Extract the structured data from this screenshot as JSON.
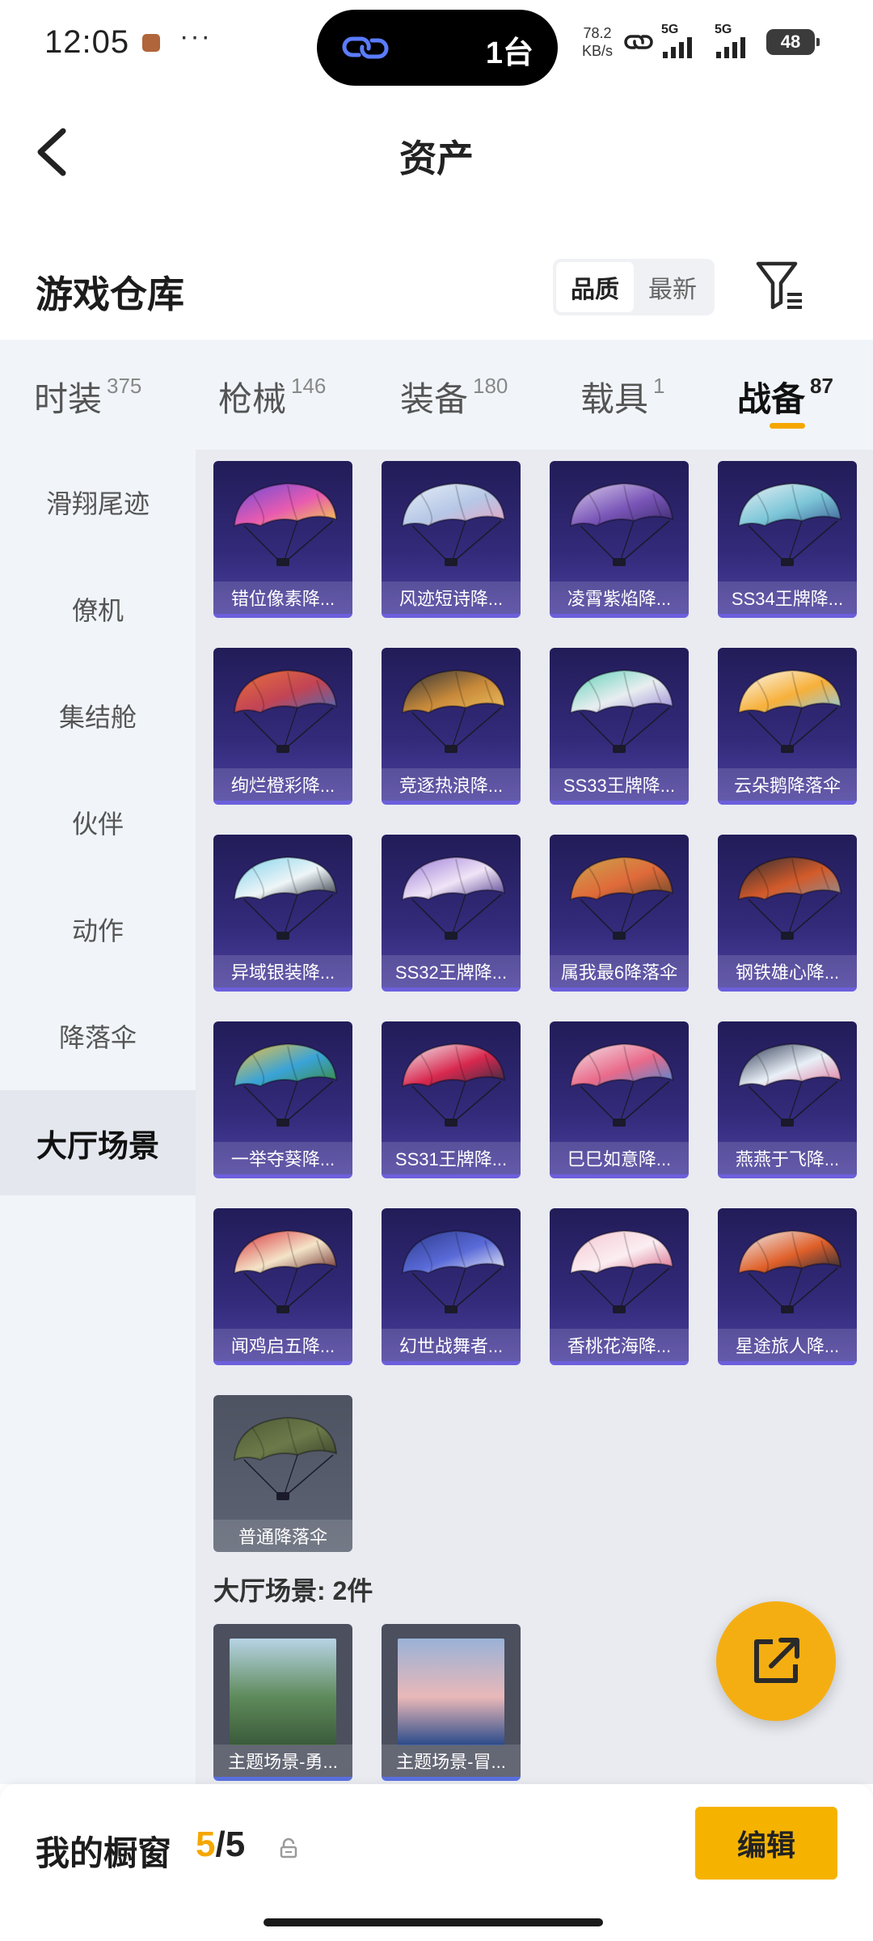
{
  "status_bar": {
    "time": "12:05",
    "more": "···",
    "island_text": "1台",
    "speed_value": "78.2",
    "speed_unit": "KB/s",
    "signal1": "5G",
    "signal2": "5G",
    "battery": "48"
  },
  "header": {
    "title": "资产"
  },
  "section": {
    "title": "游戏仓库",
    "sort_options": [
      "品质",
      "最新"
    ],
    "sort_active": "品质"
  },
  "tabs": [
    {
      "label": "时装",
      "count": "375"
    },
    {
      "label": "枪械",
      "count": "146"
    },
    {
      "label": "装备",
      "count": "180"
    },
    {
      "label": "载具",
      "count": "1"
    },
    {
      "label": "战备",
      "count": "87"
    }
  ],
  "active_tab": "战备",
  "sidebar": {
    "items": [
      "滑翔尾迹",
      "僚机",
      "集结舱",
      "伙伴",
      "动作",
      "降落伞",
      "大厅场景"
    ],
    "active": "大厅场景"
  },
  "parachutes": [
    {
      "name": "错位像素降...",
      "colors": [
        "#6a4bd8",
        "#e85bb0",
        "#f2d04a"
      ]
    },
    {
      "name": "风迹短诗降...",
      "colors": [
        "#e6eef7",
        "#b6c7e6",
        "#e7a5c5"
      ]
    },
    {
      "name": "凌霄紫焰降...",
      "colors": [
        "#d8ccec",
        "#7a56b8",
        "#3b2a6e"
      ]
    },
    {
      "name": "SS34王牌降...",
      "colors": [
        "#e9f0f5",
        "#7cc6d8",
        "#3c5f96"
      ]
    },
    {
      "name": "绚烂橙彩降...",
      "colors": [
        "#e8703a",
        "#c24455",
        "#4a6cb8"
      ]
    },
    {
      "name": "竞逐热浪降...",
      "colors": [
        "#2e3138",
        "#c88a3a",
        "#f0c060"
      ]
    },
    {
      "name": "SS33王牌降...",
      "colors": [
        "#5dd0b8",
        "#e9eef0",
        "#9a8ad8"
      ]
    },
    {
      "name": "云朵鹅降落伞",
      "colors": [
        "#fbfbf6",
        "#f7b03a",
        "#8ecbe8"
      ]
    },
    {
      "name": "异域银装降...",
      "colors": [
        "#7fd2ec",
        "#eef5f7",
        "#2b3140"
      ]
    },
    {
      "name": "SS32王牌降...",
      "colors": [
        "#9a7bd6",
        "#f0e4f7",
        "#4d3a8c"
      ]
    },
    {
      "name": "属我最6降落伞",
      "colors": [
        "#c9a64e",
        "#e06a3a",
        "#6b4a2a"
      ]
    },
    {
      "name": "钢铁雄心降...",
      "colors": [
        "#2a2d33",
        "#d35a2a",
        "#8a8f98"
      ]
    },
    {
      "name": "一举夺葵降...",
      "colors": [
        "#f4c43a",
        "#3aa3d8",
        "#3e8a3a"
      ]
    },
    {
      "name": "SS31王牌降...",
      "colors": [
        "#f2f2f6",
        "#d8284e",
        "#2c2d46"
      ]
    },
    {
      "name": "巳巳如意降...",
      "colors": [
        "#f3e4ea",
        "#e96a8a",
        "#4a8ad8"
      ]
    },
    {
      "name": "燕燕于飞降...",
      "colors": [
        "#2a3550",
        "#e9f0f7",
        "#e07aa0"
      ]
    },
    {
      "name": "闻鸡启五降...",
      "colors": [
        "#d8323a",
        "#f4e4c8",
        "#6a2a2a"
      ]
    },
    {
      "name": "幻世战舞者...",
      "colors": [
        "#2c3a8a",
        "#5a6ad8",
        "#eef0f8"
      ]
    },
    {
      "name": "香桃花海降...",
      "colors": [
        "#f5c6d2",
        "#fbeef2",
        "#d86a8a"
      ]
    },
    {
      "name": "星途旅人降...",
      "colors": [
        "#eef2f6",
        "#e0602a",
        "#1e2a3a"
      ]
    },
    {
      "name": "普通降落伞",
      "colors": [
        "#4e5a36",
        "#6c7a4a",
        "#39422a"
      ]
    }
  ],
  "scenes_section": {
    "heading": "大厅场景: 2件",
    "items": [
      {
        "name": "主题场景-勇...",
        "colors": [
          "#b8d4e6",
          "#5e8a5a",
          "#3a5a3a"
        ]
      },
      {
        "name": "主题场景-冒...",
        "colors": [
          "#9ab2d8",
          "#e9b8b8",
          "#2a4a8a"
        ]
      }
    ]
  },
  "bottom_bar": {
    "title": "我的橱窗",
    "count_current": "5",
    "count_total": "/5",
    "edit_label": "编辑"
  },
  "accent_color": "#f5a700"
}
